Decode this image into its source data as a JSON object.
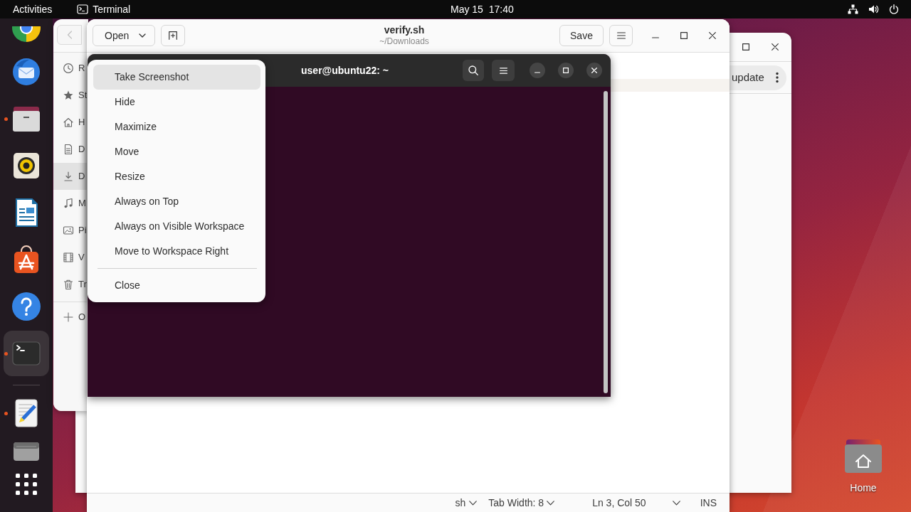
{
  "top_bar": {
    "activities": "Activities",
    "app_name": "Terminal",
    "clock": "May 15  17:40"
  },
  "dock": {
    "items": [
      {
        "kind": "browser",
        "running": false,
        "selected": false
      },
      {
        "kind": "mail",
        "running": false,
        "selected": false
      },
      {
        "kind": "files",
        "running": true,
        "selected": false
      },
      {
        "kind": "music",
        "running": false,
        "selected": false
      },
      {
        "kind": "writer",
        "running": false,
        "selected": false
      },
      {
        "kind": "store",
        "running": false,
        "selected": false
      },
      {
        "kind": "help",
        "running": false,
        "selected": false
      },
      {
        "kind": "terminal",
        "running": true,
        "selected": true
      }
    ],
    "other_items": [
      {
        "kind": "editor",
        "running": true,
        "selected": false
      },
      {
        "kind": "drive",
        "running": false,
        "selected": false
      }
    ]
  },
  "background_window": {
    "update_button": "update"
  },
  "file_manager": {
    "back_button": {
      "disabled": true
    },
    "places": [
      {
        "kind": "recent",
        "label": "R",
        "selected": false
      },
      {
        "kind": "starred",
        "label": "St",
        "selected": false
      },
      {
        "kind": "home",
        "label": "H",
        "selected": false
      },
      {
        "kind": "documents",
        "label": "D",
        "selected": false
      },
      {
        "kind": "downloads",
        "label": "D",
        "selected": true
      },
      {
        "kind": "music",
        "label": "M",
        "selected": false
      },
      {
        "kind": "pictures",
        "label": "Pi",
        "selected": false
      },
      {
        "kind": "videos",
        "label": "V",
        "selected": false
      },
      {
        "kind": "trash",
        "label": "Tr",
        "selected": false
      }
    ],
    "other_locations": {
      "label": "O"
    }
  },
  "editor": {
    "title": "verify.sh",
    "subtitle": "~/Downloads",
    "open_button": "Open",
    "save_button": "Save",
    "status_bar": {
      "language": "sh",
      "tab_width": "Tab Width: 8",
      "position": "Ln 3, Col 50",
      "mode": "INS"
    }
  },
  "terminal": {
    "title": "user@ubuntu22: ~"
  },
  "context_menu": {
    "groups": [
      [
        {
          "label": "Take Screenshot",
          "selected": true
        },
        {
          "label": "Hide",
          "selected": false
        },
        {
          "label": "Maximize",
          "selected": false
        },
        {
          "label": "Move",
          "selected": false
        },
        {
          "label": "Resize",
          "selected": false
        },
        {
          "label": "Always on Top",
          "selected": false
        },
        {
          "label": "Always on Visible Workspace",
          "selected": false
        },
        {
          "label": "Move to Workspace Right",
          "selected": false
        }
      ],
      [
        {
          "label": "Close",
          "selected": false
        }
      ]
    ]
  },
  "desktop": {
    "icons": [
      {
        "label": "Home"
      }
    ]
  }
}
